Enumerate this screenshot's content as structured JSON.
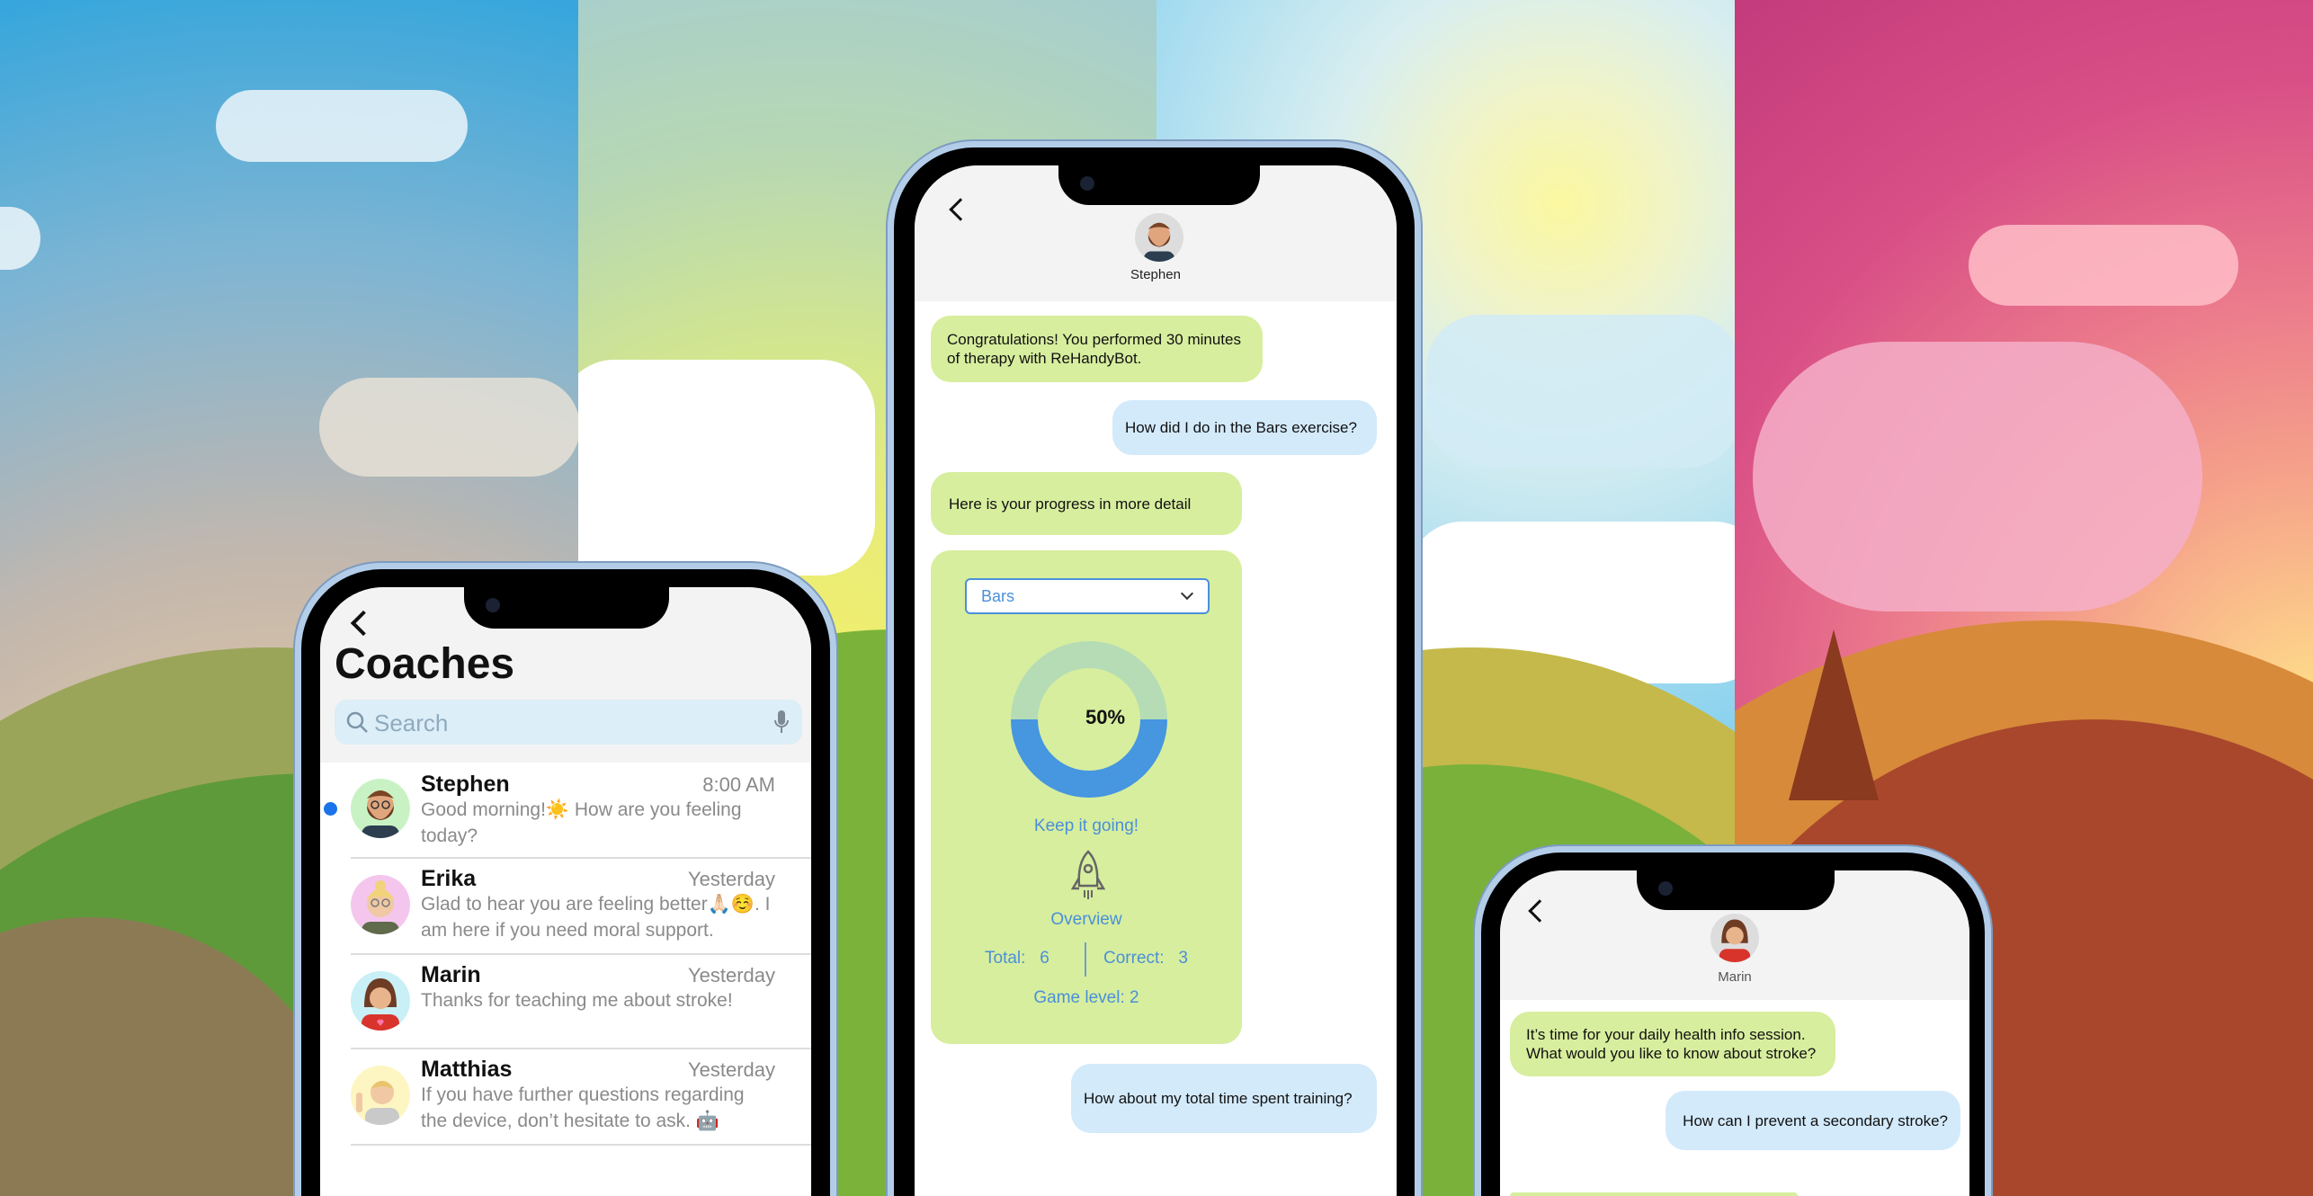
{
  "colors": {
    "accent": "#4a90d9",
    "bot_bubble": "#d7ee9e",
    "user_bubble": "#d3eafb",
    "unread_dot": "#1a73e8"
  },
  "coaches": {
    "back_icon": "chevron-left",
    "title": "Coaches",
    "search_placeholder": "Search",
    "items": [
      {
        "name": "Stephen",
        "time": "8:00 AM",
        "message": "Good morning!☀️ How are you feeling today?",
        "unread": true,
        "avatar_bg": "#c9f2c4"
      },
      {
        "name": "Erika",
        "time": "Yesterday",
        "message": "Glad to hear you are feeling better🙏🏻☺️. I am here if you need moral support.",
        "unread": false,
        "avatar_bg": "#f4c6ee"
      },
      {
        "name": "Marin",
        "time": "Yesterday",
        "message": "Thanks for teaching me about stroke!",
        "unread": false,
        "avatar_bg": "#c8f0f6"
      },
      {
        "name": "Matthias",
        "time": "Yesterday",
        "message": "If you have further questions regarding the device, don’t hesitate to ask. 🤖",
        "unread": false,
        "avatar_bg": "#fdf6c2"
      }
    ]
  },
  "chat_stephen": {
    "contact": "Stephen",
    "messages": [
      {
        "from": "coach",
        "text": "Congratulations! You performed 30 minutes of therapy with ReHandyBot."
      },
      {
        "from": "user",
        "text": "How did I do in the Bars exercise?"
      },
      {
        "from": "coach",
        "text": "Here is your progress in more detail"
      },
      {
        "from": "user",
        "text": "How about my total time spent training?"
      }
    ],
    "progress_card": {
      "exercise_select": "Bars",
      "progress_percent": 50,
      "progress_label": "50%",
      "motivation": "Keep it going!",
      "overview_label": "Overview",
      "total_label": "Total:",
      "total_value": "6",
      "correct_label": "Correct:",
      "correct_value": "3",
      "game_level": "Game level: 2"
    }
  },
  "chat_marin": {
    "contact": "Marin",
    "messages": [
      {
        "from": "coach",
        "text": "It’s time for your daily health info session. What would you like to know about stroke?"
      },
      {
        "from": "user",
        "text": "How can I prevent a secondary stroke?"
      }
    ]
  }
}
